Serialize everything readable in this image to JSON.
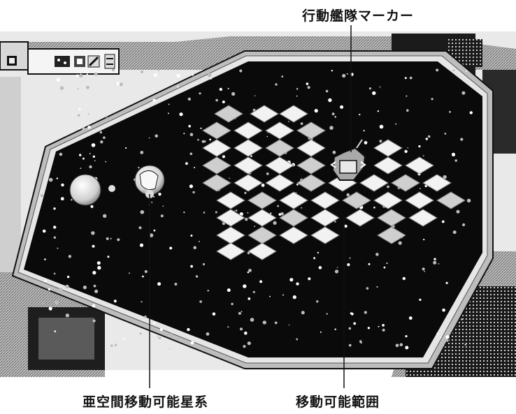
{
  "annotations": {
    "fleet_marker": "行動艦隊マーカー",
    "hyperspace_system": "亜空間移動可能星系",
    "movement_range": "移動可能範囲"
  },
  "icons": [
    "toolbar-grid-icon",
    "toolbar-stars-icon",
    "toolbar-ship-icon",
    "toolbar-slash-icon",
    "toolbar-arrows-icon",
    "fleet-marker-icon",
    "planet-icon"
  ],
  "colors": {
    "board": "#0a0a0a",
    "tile_light": "#f2f2f2",
    "tile_mid": "#cfcfcf",
    "frame": "#9a9a9a"
  }
}
